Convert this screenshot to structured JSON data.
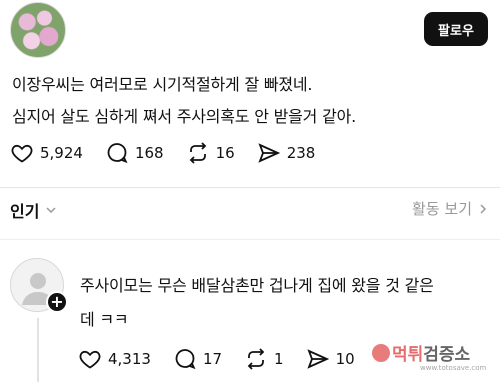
{
  "post": {
    "follow_label": "팔로우",
    "text_line1": "이장우씨는 여러모로 시기적절하게 잘 빠졌네.",
    "text_line2": "심지어 살도 심하게 쪄서 주사의혹도 안 받을거 같아.",
    "likes": "5,924",
    "comments": "168",
    "reposts": "16",
    "shares": "238"
  },
  "sort": {
    "label": "인기",
    "activity_link": "활동 보기"
  },
  "reply": {
    "text_line1": "주사이모는 무슨 배달삼촌만 겁나게 집에 왔을 것 같은",
    "text_line2": "데 ㅋㅋ",
    "likes": "4,313",
    "comments": "17",
    "reposts": "1",
    "shares": "10"
  },
  "watermark": {
    "name_red": "먹튀",
    "name_dark": "검증소",
    "url": "www.totosave.com"
  }
}
